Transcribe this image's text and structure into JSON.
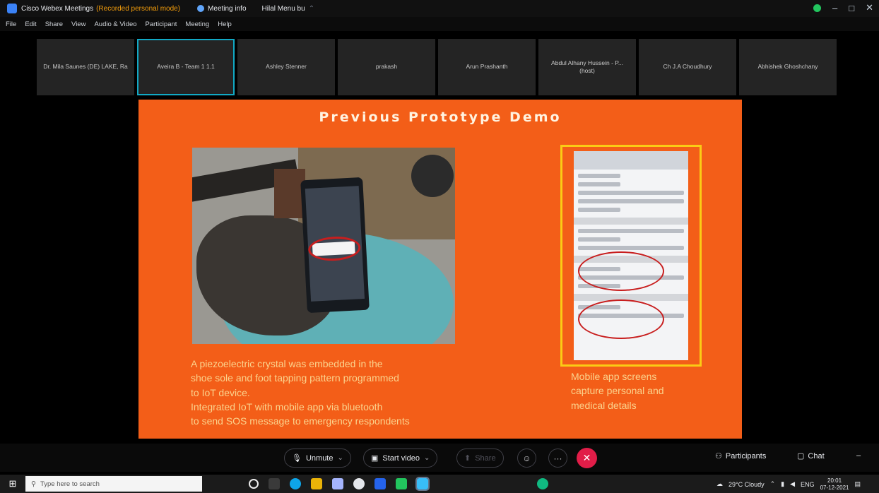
{
  "window": {
    "app_name": "Cisco Webex Meetings",
    "mode_label": "(Recorded personal mode)",
    "meeting_info": "Meeting info",
    "host_label": "Hilal Menu bu",
    "controls": [
      "–",
      "□",
      "✕"
    ]
  },
  "menu": [
    "File",
    "Edit",
    "Share",
    "View",
    "Audio & Video",
    "Participant",
    "Meeting",
    "Help"
  ],
  "participants": [
    "Dr. Mila Saunes (DE) LAKE, Ra",
    "Aveira B - Team 1 1.1",
    "Ashley Stenner",
    "prakash",
    "Arun Prashanth",
    "Abdul Alhany Hussein - P... (host)",
    "Ch J.A Choudhury",
    "Abhishek Ghoshchany"
  ],
  "slide": {
    "title": "Previous Prototype Demo",
    "left_text": [
      "A piezoelectric crystal was embedded in the",
      "shoe sole and foot tapping pattern programmed",
      "to IoT device.",
      "Integrated IoT with mobile app via bluetooth",
      "to send SOS message to emergency respondents"
    ],
    "right_text": [
      "Mobile app screens",
      "capture personal and",
      "medical details"
    ]
  },
  "call_controls": {
    "unmute": "Unmute",
    "start_video": "Start video",
    "share": "Share",
    "participants": "Participants",
    "chat": "Chat"
  },
  "taskbar": {
    "search_placeholder": "Type here to search",
    "weather": "29°C Cloudy",
    "lang": "ENG",
    "time": "20:01",
    "date": "07-12-2021"
  },
  "colors": {
    "slide_bg": "#f35e18",
    "active_tile_border": "#12a9c5",
    "end_call": "#e11d48",
    "highlight_frame": "#facc15"
  }
}
